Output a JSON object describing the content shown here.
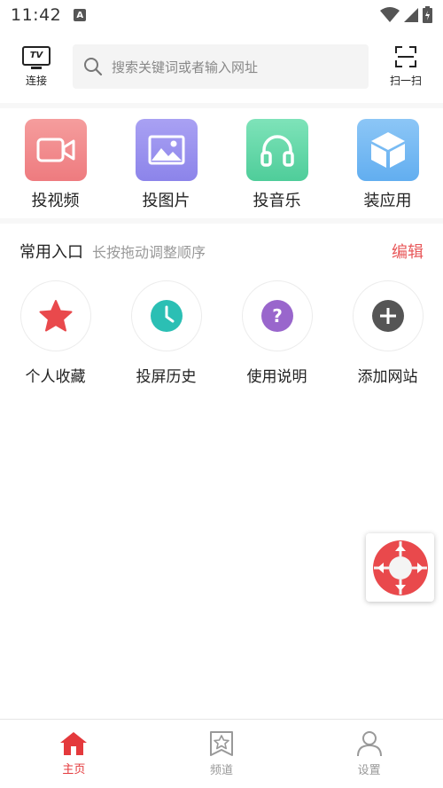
{
  "status_bar": {
    "time": "11:42",
    "notification_badge": "A"
  },
  "top_bar": {
    "tv_badge": "TV",
    "tv_label": "连接",
    "search_placeholder": "搜索关键词或者输入网址",
    "scan_label": "扫一扫"
  },
  "features": [
    {
      "label": "投视频",
      "icon": "video-camera-icon",
      "color": "#f08b8b"
    },
    {
      "label": "投图片",
      "icon": "image-icon",
      "color": "#9b92ee"
    },
    {
      "label": "投音乐",
      "icon": "headphones-icon",
      "color": "#5fd6a6"
    },
    {
      "label": "装应用",
      "icon": "cube-icon",
      "color": "#6fb6f2"
    }
  ],
  "favorites": {
    "title": "常用入口",
    "hint": "长按拖动调整顺序",
    "edit_label": "编辑",
    "items": [
      {
        "label": "个人收藏",
        "icon": "star-icon",
        "color": "#e9494c"
      },
      {
        "label": "投屏历史",
        "icon": "clock-icon",
        "color": "#2bbfb4"
      },
      {
        "label": "使用说明",
        "icon": "question-icon",
        "color": "#9966cc"
      },
      {
        "label": "添加网站",
        "icon": "plus-icon",
        "color": "#555555"
      }
    ]
  },
  "bottom_nav": [
    {
      "label": "主页",
      "icon": "home-icon",
      "active": true
    },
    {
      "label": "频道",
      "icon": "channel-star-icon",
      "active": false
    },
    {
      "label": "设置",
      "icon": "person-icon",
      "active": false
    }
  ],
  "colors": {
    "accent": "#e4393c",
    "edit": "#e8585a"
  }
}
